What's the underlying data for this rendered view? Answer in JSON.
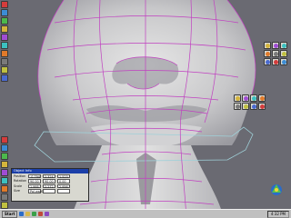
{
  "colors": {
    "viewport_bg": "#6a6a72",
    "mesh_wire": "#c040c0",
    "model_light": "#dcdcdc",
    "model_dark": "#8f8f95",
    "guide_line": "#9fd0d8",
    "panel_title": "#1b3fa8"
  },
  "object_panel": {
    "title": "Object Info",
    "rows": [
      {
        "label": "Position",
        "values": [
          "-0.794",
          "2.324",
          "1.523"
        ]
      },
      {
        "label": "Rotation",
        "values": [
          "90.00",
          "90.00",
          "0.00"
        ]
      },
      {
        "label": "Scale",
        "values": [
          "1.995",
          "2.272",
          "2.956"
        ]
      },
      {
        "label": "Size",
        "values": [
          "Pal.wsd0fd",
          "",
          ""
        ]
      }
    ]
  },
  "taskbar": {
    "start_label": "Start",
    "clock": "4:32 PM"
  },
  "left_toolbar_top_icons": [
    "select-icon",
    "move-icon",
    "rotate-icon",
    "scale-icon",
    "zoom-icon",
    "pan-icon",
    "camera-icon",
    "light-icon",
    "grid-icon",
    "render-icon"
  ],
  "left_toolbar_bottom_icons": [
    "point-icon",
    "edge-icon",
    "face-icon",
    "object-icon",
    "group-icon",
    "material-icon",
    "texture-icon",
    "undo-icon",
    "redo-icon"
  ],
  "cluster_top_icons": [
    "sphere-icon",
    "cube-icon",
    "cylinder-icon",
    "cone-icon",
    "torus-icon",
    "plane-icon",
    "lathe-icon",
    "extrude-icon",
    "sweep-icon"
  ],
  "cluster_bottom_icons": [
    "smooth-icon",
    "tweak-icon",
    "sculpt-icon",
    "cut-icon",
    "weld-icon",
    "bevel-icon",
    "knife-icon",
    "mirror-icon"
  ]
}
